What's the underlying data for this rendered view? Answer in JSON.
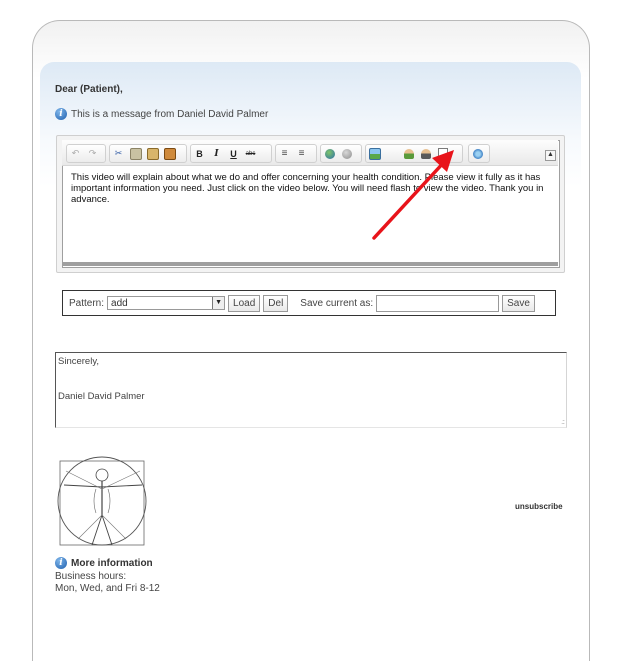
{
  "greeting": "Dear (Patient),",
  "message_notice": "This is a message from Daniel David Palmer",
  "editor": {
    "body": "This video will explain about what we do and offer concerning your health condition. Please view it fully as it has important information you need. Just click on the video below. You will need flash to view the video. Thank you in advance.",
    "toolbar_icons": [
      "undo-icon",
      "redo-icon",
      "cut-icon",
      "copy-icon",
      "paste-icon",
      "paste-word-icon",
      "bold-icon",
      "italic-icon",
      "underline-icon",
      "strikethrough-icon",
      "numbered-list-icon",
      "bulleted-list-icon",
      "link-icon",
      "unlink-icon",
      "image-icon",
      "contact-icon",
      "contact-group-icon",
      "document-icon",
      "video-icon"
    ],
    "bold_label": "B",
    "italic_label": "I",
    "underline_label": "U",
    "strike_label": "abc"
  },
  "pattern": {
    "label": "Pattern:",
    "selected": "add",
    "load_label": "Load",
    "del_label": "Del",
    "save_as_label": "Save current as:",
    "save_value": "",
    "save_label": "Save"
  },
  "signature": {
    "closing": "Sincerely,",
    "name": "Daniel David Palmer"
  },
  "footer": {
    "unsubscribe": "unsubscribe",
    "more_info": "More information",
    "hours_label": "Business hours:",
    "hours_value": "Mon, Wed, and Fri 8-12"
  },
  "colors": {
    "annotation_arrow": "#e8131a",
    "info_icon": "#1e5fae",
    "panel_gradient": "#dde9f5"
  }
}
